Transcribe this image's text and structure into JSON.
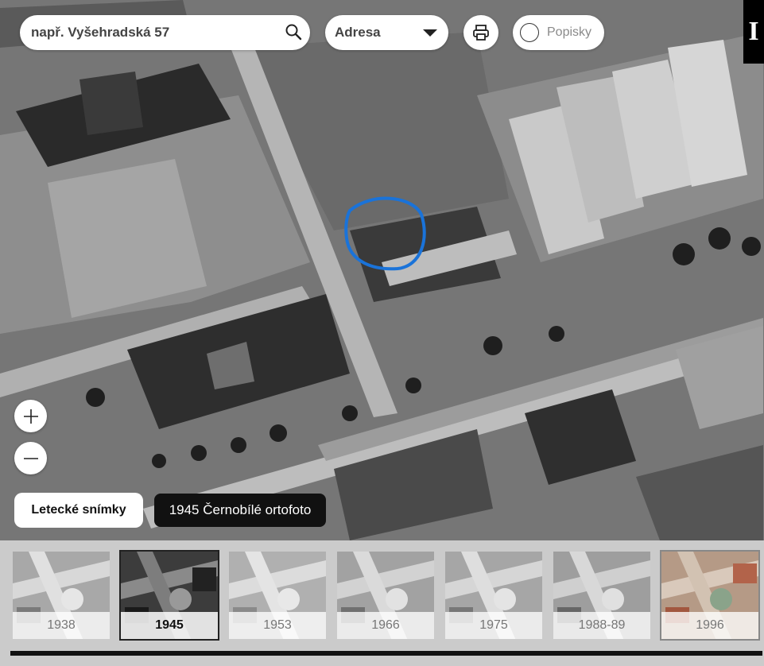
{
  "search": {
    "placeholder": "např. Vyšehradská 57"
  },
  "search_type": {
    "selected": "Adresa"
  },
  "labels_toggle": {
    "label": "Popisky"
  },
  "corner_badge": "I",
  "layer_button": {
    "label": "Letecké snímky"
  },
  "current_layer": {
    "label": "1945 Černobílé ortofoto"
  },
  "timeline": [
    {
      "year": "1938",
      "active": false
    },
    {
      "year": "1945",
      "active": true
    },
    {
      "year": "1953",
      "active": false
    },
    {
      "year": "1966",
      "active": false
    },
    {
      "year": "1975",
      "active": false
    },
    {
      "year": "1988-89",
      "active": false
    },
    {
      "year": "1996",
      "active": false
    }
  ],
  "icons": [
    "search-icon",
    "chevron-down-icon",
    "printer-icon",
    "radio-circle-icon",
    "plus-icon",
    "minus-icon"
  ],
  "colors": {
    "highlight": "#1a73d9",
    "active_border": "#222222",
    "label_bg": "#111111"
  }
}
